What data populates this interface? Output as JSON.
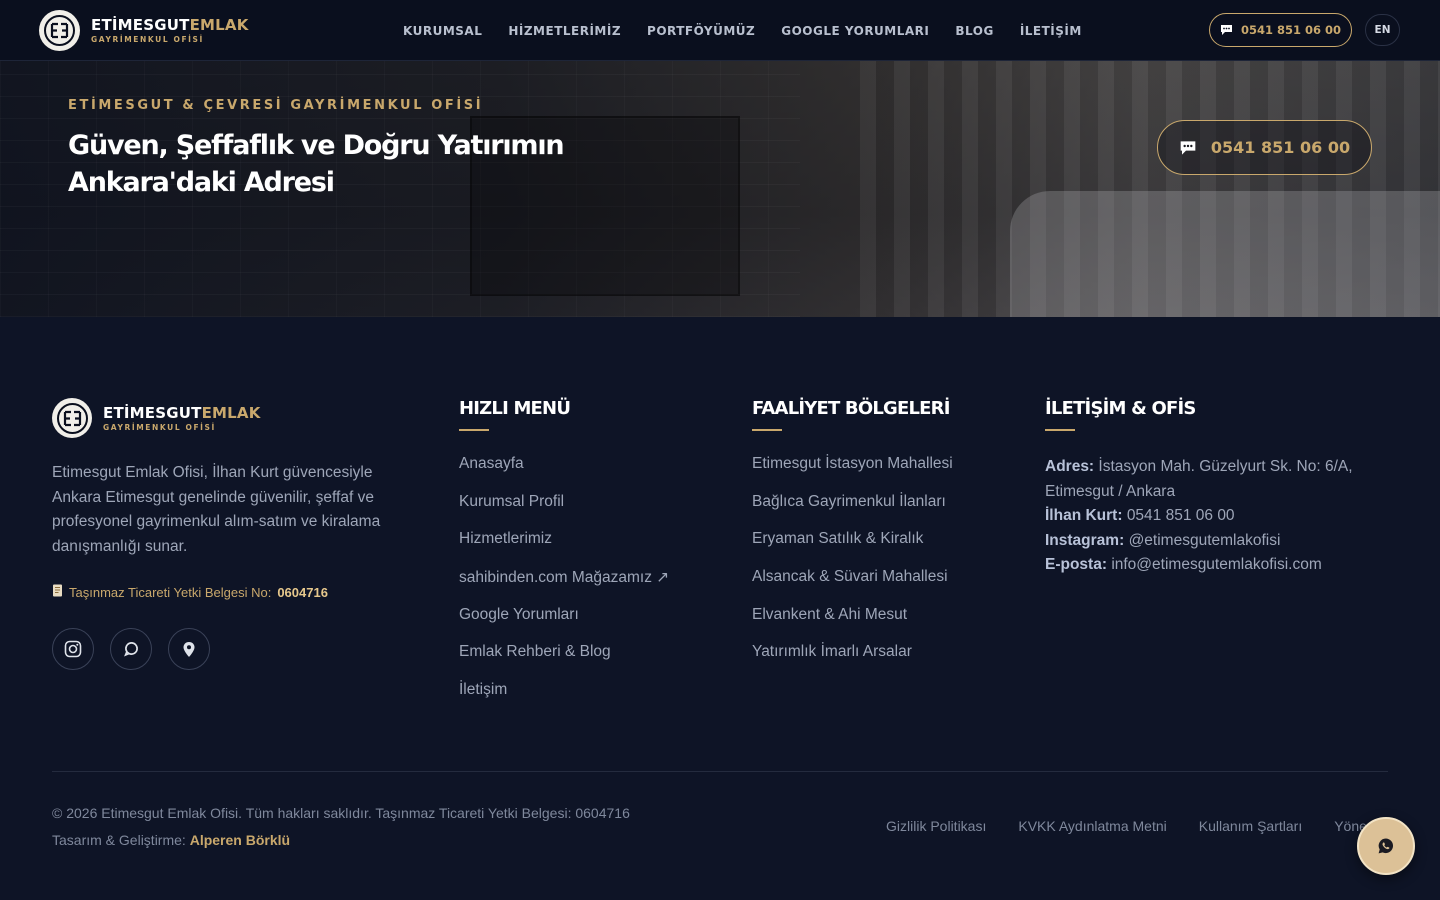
{
  "header": {
    "logo": {
      "brand_white": "ETİMESGUT",
      "brand_gold": "EMLAK",
      "sub": "GAYRİMENKUL OFİSİ"
    },
    "nav": [
      {
        "label": "KURUMSAL"
      },
      {
        "label": "HİZMETLERİMİZ"
      },
      {
        "label": "PORTFÖYÜMÜZ"
      },
      {
        "label": "GOOGLE YORUMLARI"
      },
      {
        "label": "BLOG"
      },
      {
        "label": "İLETİŞİM"
      }
    ],
    "phone": "0541 851 06 00",
    "lang": "EN"
  },
  "hero": {
    "eyebrow": "ETİMESGUT & ÇEVRESİ GAYRİMENKUL OFİSİ",
    "title": "Güven, Şeffaflık ve Doğru Yatırımın Ankara'daki Adresi",
    "phone": "0541 851 06 00"
  },
  "footer": {
    "logo": {
      "brand_white": "ETİMESGUT",
      "brand_gold": "EMLAK",
      "sub": "GAYRİMENKUL OFİSİ"
    },
    "about": "Etimesgut Emlak Ofisi, İlhan Kurt güvencesiyle Ankara Etimesgut genelinde güvenilir, şeffaf ve profesyonel gayrimenkul alım-satım ve kiralama danışmanlığı sunar.",
    "license_label": "Taşınmaz Ticareti Yetki Belgesi No:",
    "license_no": "0604716",
    "quick_menu": {
      "title": "HIZLI MENÜ",
      "items": [
        "Anasayfa",
        "Kurumsal Profil",
        "Hizmetlerimiz",
        "sahibinden.com Mağazamız ↗",
        "Google Yorumları",
        "Emlak Rehberi & Blog",
        "İletişim"
      ]
    },
    "regions": {
      "title": "FAALİYET BÖLGELERİ",
      "items": [
        "Etimesgut İstasyon Mahallesi",
        "Bağlıca Gayrimenkul İlanları",
        "Eryaman Satılık & Kiralık",
        "Alsancak & Süvari Mahallesi",
        "Elvankent & Ahi Mesut",
        "Yatırımlık İmarlı Arsalar"
      ]
    },
    "contact": {
      "title": "İLETİŞİM & OFİS",
      "address_label": "Adres:",
      "address": "İstasyon Mah. Güzelyurt Sk. No: 6/A, Etimesgut / Ankara",
      "person_label": "İlhan Kurt:",
      "person_phone": "0541 851 06 00",
      "instagram_label": "Instagram:",
      "instagram": "@etimesgutemlakofisi",
      "email_label": "E-posta:",
      "email": "info@etimesgutemlakofisi.com"
    },
    "copyright": "© 2026 Etimesgut Emlak Ofisi. Tüm hakları saklıdır. Taşınmaz Ticareti Yetki Belgesi: 0604716",
    "credit_label": "Tasarım & Geliştirme:",
    "credit_name": "Alperen Börklü",
    "legal": [
      "Gizlilik Politikası",
      "KVKK Aydınlatma Metni",
      "Kullanım Şartları",
      "Yönetim"
    ]
  },
  "colors": {
    "gold": "#c9a86c",
    "background": "#0e1426",
    "header": "#0a0f1e"
  }
}
